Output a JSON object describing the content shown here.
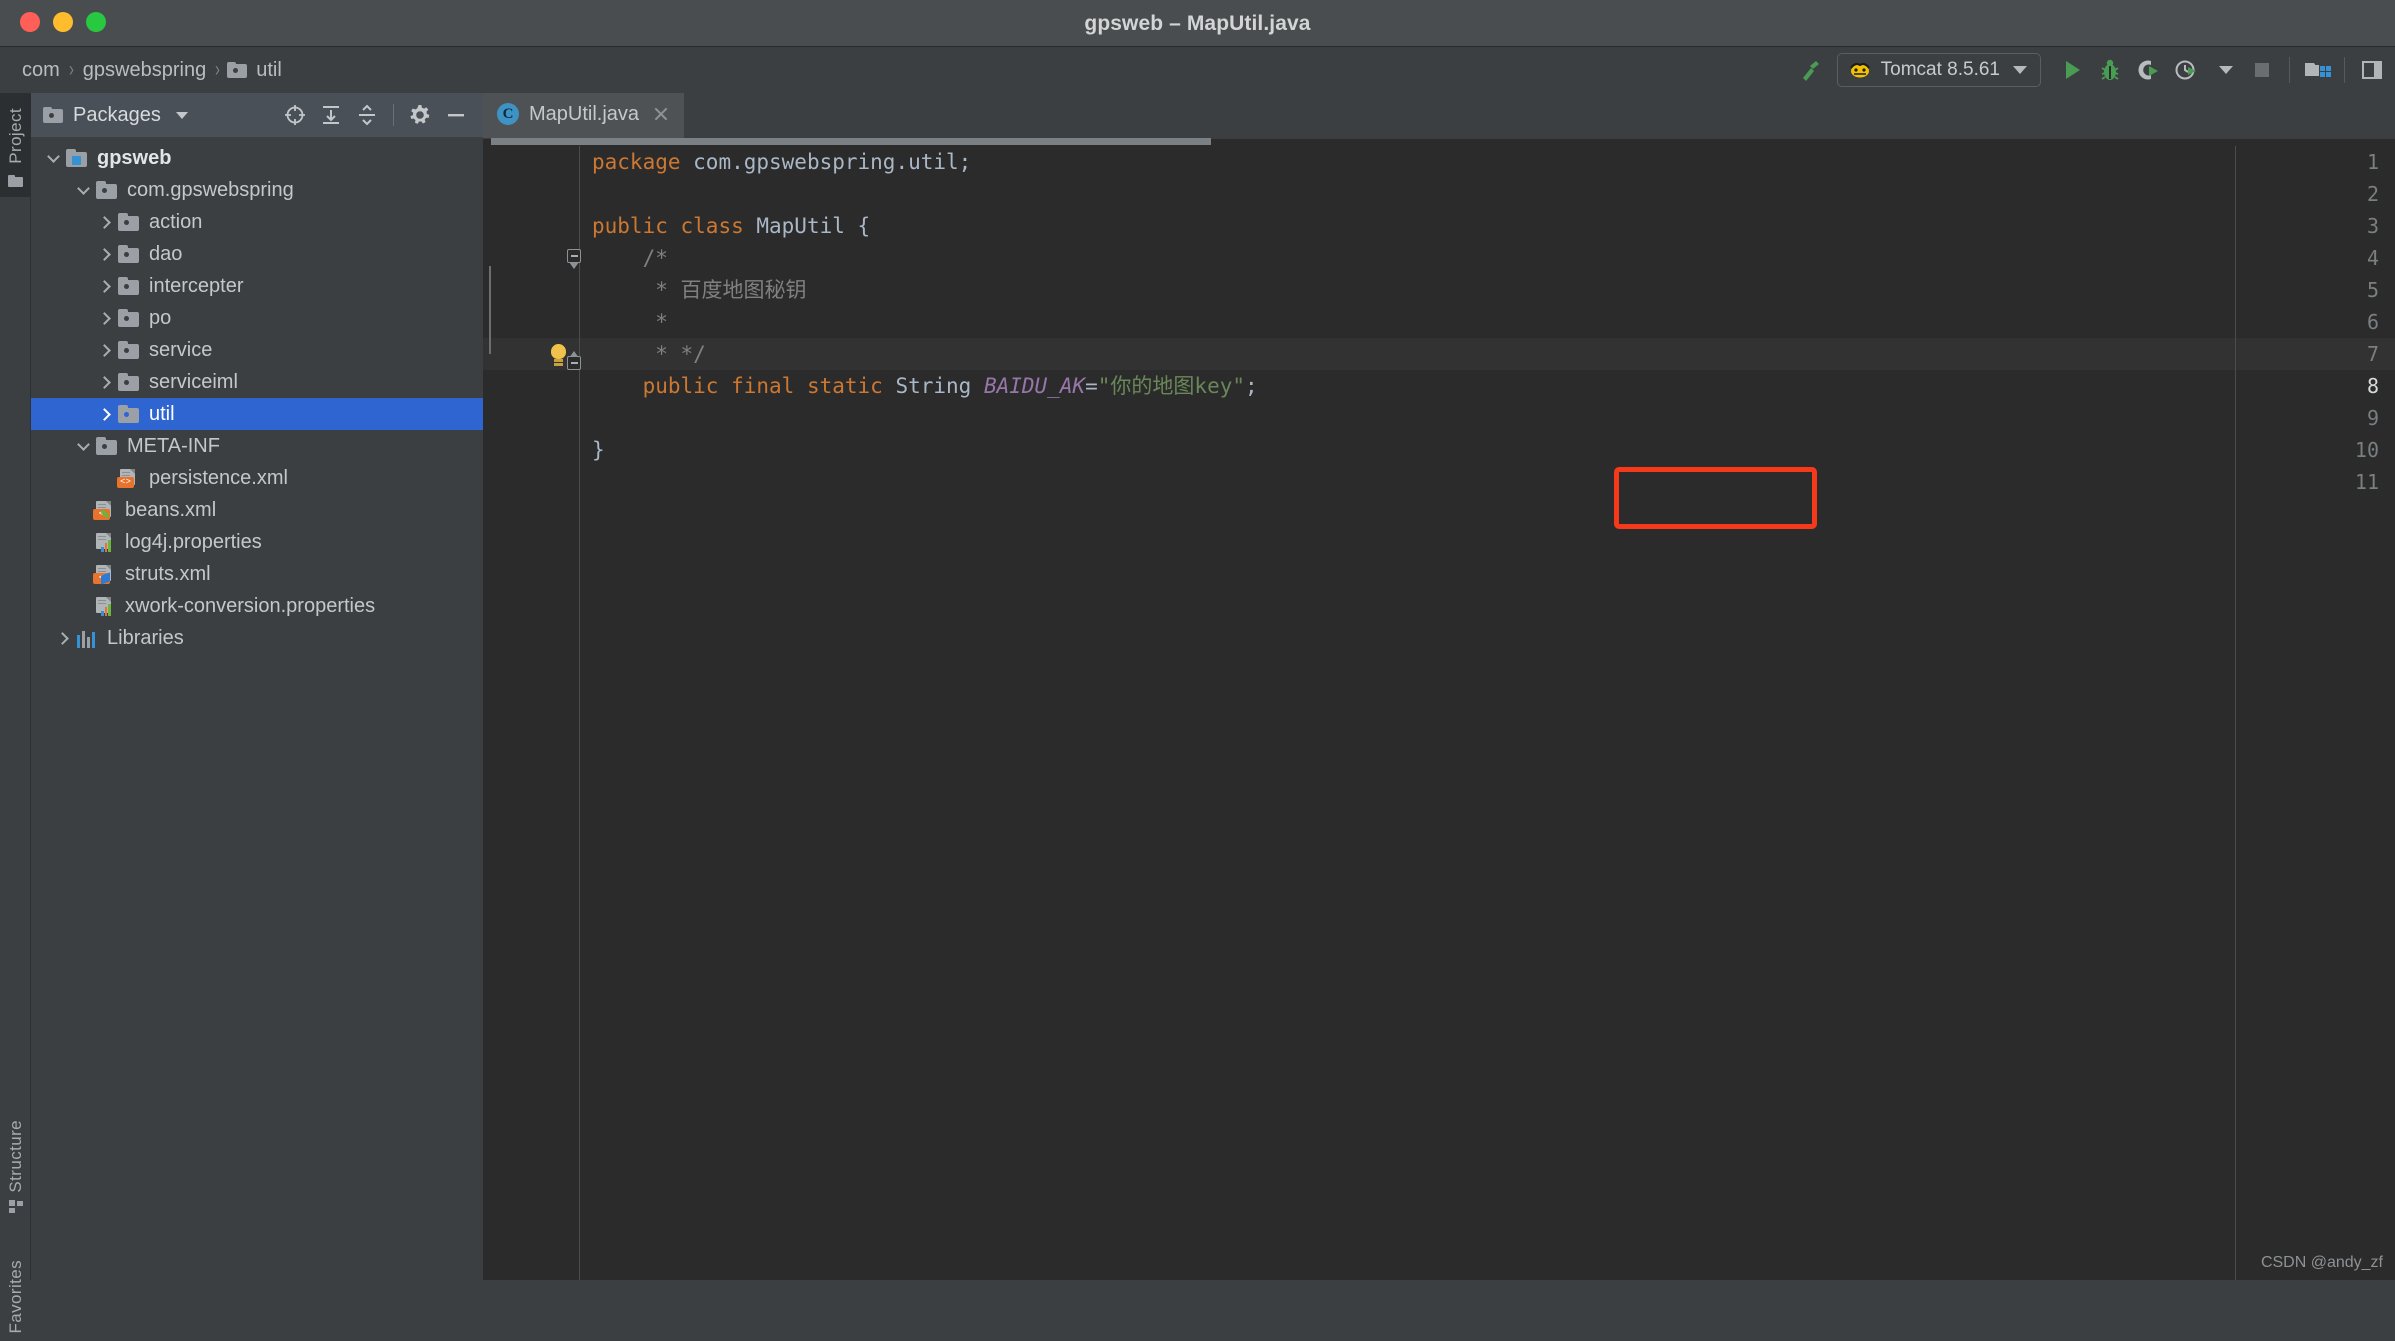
{
  "window": {
    "title": "gpsweb – MapUtil.java",
    "controls": [
      "close",
      "minimize",
      "maximize"
    ]
  },
  "navbar": {
    "breadcrumb": [
      {
        "label": "com",
        "icon": null
      },
      {
        "label": "gpswebspring",
        "icon": null
      },
      {
        "label": "util",
        "icon": "folder-icon"
      }
    ],
    "separator": "›",
    "run_config": {
      "name": "Tomcat 8.5.61",
      "icon": "tomcat-icon",
      "dropdown": "▾"
    },
    "buttons": [
      {
        "name": "build-project-button",
        "icon": "hammer-icon"
      },
      {
        "name": "run-button",
        "icon": "play-icon"
      },
      {
        "name": "debug-button",
        "icon": "bug-icon"
      },
      {
        "name": "run-with-coverage-button",
        "icon": "coverage-icon"
      },
      {
        "name": "profiler-button",
        "icon": "profiler-icon"
      },
      {
        "name": "stop-button",
        "icon": "stop-square-icon"
      },
      {
        "name": "project-structure-button",
        "icon": "project-structure-icon"
      },
      {
        "name": "more-button",
        "icon": "panel-icon"
      }
    ]
  },
  "stripe": {
    "project": "Project",
    "structure": "Structure",
    "favorites": "Favorites"
  },
  "project_panel": {
    "title": "Packages",
    "title_icon": "folder-icon",
    "dropdown": "▾",
    "tools": [
      {
        "name": "scroll-from-source-button",
        "icon": "target-icon"
      },
      {
        "name": "expand-all-button",
        "icon": "expand-all-icon"
      },
      {
        "name": "collapse-all-button",
        "icon": "collapse-all-icon"
      },
      {
        "name": "settings-button",
        "icon": "gear-icon"
      },
      {
        "name": "hide-button",
        "icon": "minimize-icon"
      }
    ],
    "tree": [
      {
        "label": "gpsweb",
        "indent": 0,
        "twisty": "down",
        "icon": "module-icon",
        "bold": true,
        "selected": false
      },
      {
        "label": "com.gpswebspring",
        "indent": 1,
        "twisty": "down",
        "icon": "package-icon",
        "bold": false,
        "selected": false
      },
      {
        "label": "action",
        "indent": 2,
        "twisty": "right",
        "icon": "package-icon",
        "bold": false,
        "selected": false
      },
      {
        "label": "dao",
        "indent": 2,
        "twisty": "right",
        "icon": "package-icon",
        "bold": false,
        "selected": false
      },
      {
        "label": "intercepter",
        "indent": 2,
        "twisty": "right",
        "icon": "package-icon",
        "bold": false,
        "selected": false
      },
      {
        "label": "po",
        "indent": 2,
        "twisty": "right",
        "icon": "package-icon",
        "bold": false,
        "selected": false
      },
      {
        "label": "service",
        "indent": 2,
        "twisty": "right",
        "icon": "package-icon",
        "bold": false,
        "selected": false
      },
      {
        "label": "serviceiml",
        "indent": 2,
        "twisty": "right",
        "icon": "package-icon",
        "bold": false,
        "selected": false
      },
      {
        "label": "util",
        "indent": 2,
        "twisty": "right",
        "icon": "package-icon",
        "bold": false,
        "selected": true
      },
      {
        "label": "META-INF",
        "indent": 1,
        "twisty": "down",
        "icon": "package-icon",
        "bold": false,
        "selected": false
      },
      {
        "label": "persistence.xml",
        "indent": 2,
        "twisty": "none",
        "icon": "xml-file-icon",
        "bold": false,
        "selected": false
      },
      {
        "label": "beans.xml",
        "indent": 1,
        "twisty": "none",
        "icon": "spring-xml-file-icon",
        "bold": false,
        "selected": false
      },
      {
        "label": "log4j.properties",
        "indent": 1,
        "twisty": "none",
        "icon": "properties-file-icon",
        "bold": false,
        "selected": false
      },
      {
        "label": "struts.xml",
        "indent": 1,
        "twisty": "none",
        "icon": "struts-xml-file-icon",
        "bold": false,
        "selected": false
      },
      {
        "label": "xwork-conversion.properties",
        "indent": 1,
        "twisty": "none",
        "icon": "properties-file-icon",
        "bold": false,
        "selected": false
      },
      {
        "label": "Libraries",
        "indent": 0,
        "twisty": "right",
        "icon": "libraries-icon",
        "bold": false,
        "selected": false
      }
    ]
  },
  "editor": {
    "tab": {
      "label": "MapUtil.java",
      "icon": "java-class-icon",
      "icon_letter": "C",
      "close": "×"
    },
    "gutter_icon": "intention-bulb-icon",
    "caret_line": 8,
    "lines": [
      {
        "no": 1,
        "tokens": [
          {
            "t": "package ",
            "c": "kw"
          },
          {
            "t": "com.gpswebspring.util;",
            "c": "id"
          }
        ]
      },
      {
        "no": 2,
        "tokens": []
      },
      {
        "no": 3,
        "tokens": [
          {
            "t": "public ",
            "c": "kw"
          },
          {
            "t": "class ",
            "c": "kw"
          },
          {
            "t": "MapUtil ",
            "c": "cls"
          },
          {
            "t": "{",
            "c": "punc"
          }
        ]
      },
      {
        "no": 4,
        "tokens": [
          {
            "t": "    /*",
            "c": "cmt"
          }
        ]
      },
      {
        "no": 5,
        "tokens": [
          {
            "t": "     * 百度地图秘钥",
            "c": "cmt"
          }
        ]
      },
      {
        "no": 6,
        "tokens": [
          {
            "t": "     *",
            "c": "cmt"
          }
        ]
      },
      {
        "no": 7,
        "tokens": [
          {
            "t": "     * */",
            "c": "cmt"
          }
        ]
      },
      {
        "no": 8,
        "tokens": [
          {
            "t": "    public ",
            "c": "kw"
          },
          {
            "t": "final ",
            "c": "kw"
          },
          {
            "t": "static ",
            "c": "kw"
          },
          {
            "t": "String ",
            "c": "cls"
          },
          {
            "t": "BAIDU_AK",
            "c": "fieldn"
          },
          {
            "t": "=",
            "c": "punc"
          },
          {
            "t": "\"你的地图key\"",
            "c": "str"
          },
          {
            "t": ";",
            "c": "punc"
          }
        ]
      },
      {
        "no": 9,
        "tokens": []
      },
      {
        "no": 10,
        "tokens": [
          {
            "t": "}",
            "c": "punc"
          }
        ]
      },
      {
        "no": 11,
        "tokens": []
      }
    ],
    "fold_markers": [
      {
        "line": 4,
        "type": "down"
      },
      {
        "line": 7,
        "type": "up"
      }
    ],
    "annotation": {
      "shape": "rectangle",
      "color": "#f5391a",
      "target_text": "\"你的地图key\";"
    }
  },
  "watermark": "CSDN @andy_zf",
  "colors": {
    "titlebar_bg": "#4a4d4f",
    "chrome_bg": "#3c3f41",
    "editor_bg": "#2b2b2b",
    "selection_blue": "#2f65d0",
    "accent_green": "#499c54",
    "annotation_red": "#f5391a",
    "string_green": "#6a8759",
    "keyword_orange": "#cc7832",
    "field_purple": "#9876aa"
  }
}
